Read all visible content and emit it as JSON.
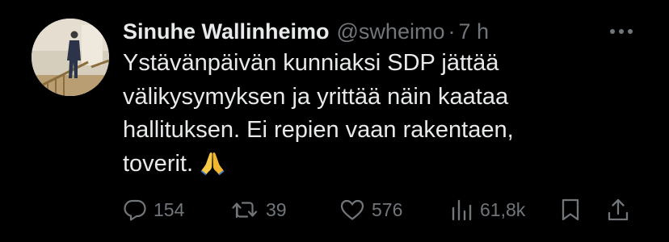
{
  "tweet": {
    "author": {
      "display_name": "Sinuhe Wallinheimo",
      "handle": "@swheimo",
      "separator": "·",
      "time": "7 h"
    },
    "text_lines": [
      "Ystävänpäivän kunniaksi SDP jättää",
      "välikysymyksen ja yrittää näin kaataa",
      "hallituksen. Ei repien vaan rakentaen,",
      "toverit."
    ],
    "emoji": "folded-hands",
    "metrics": {
      "replies": "154",
      "reposts": "39",
      "likes": "576",
      "views": "61,8k"
    }
  },
  "colors": {
    "background": "#000000",
    "text": "#e7e9ea",
    "secondary": "#71767b"
  },
  "icons": [
    "more-icon",
    "reply-icon",
    "repost-icon",
    "like-icon",
    "views-icon",
    "bookmark-icon",
    "share-icon"
  ]
}
